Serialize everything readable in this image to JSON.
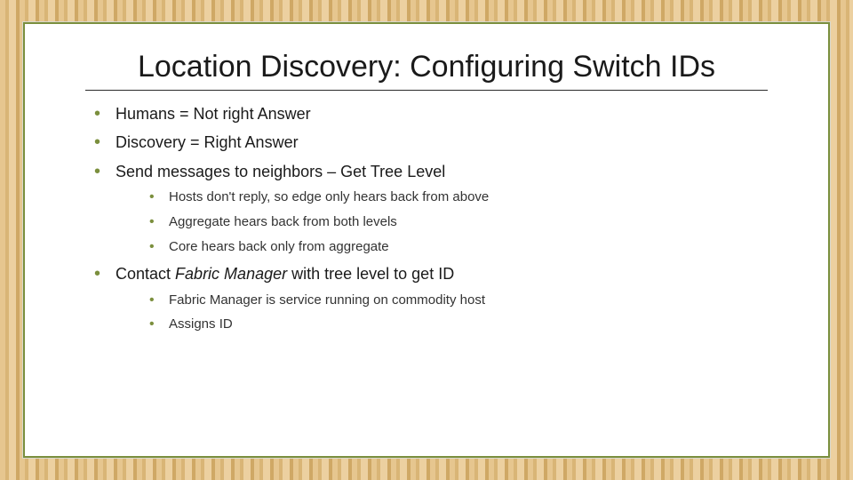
{
  "title": "Location Discovery: Configuring Switch IDs",
  "bullets": {
    "b1": "Humans = Not right Answer",
    "b2": "Discovery = Right Answer",
    "b3": "Send messages to neighbors – Get Tree Level",
    "b3_sub": {
      "s1": "Hosts don't reply, so edge only hears back from above",
      "s2": "Aggregate hears back from both levels",
      "s3": "Core hears back only from aggregate"
    },
    "b4_pre": "Contact ",
    "b4_em": "Fabric Manager",
    "b4_post": " with tree level to get ID",
    "b4_sub": {
      "s1": "Fabric Manager is service running on commodity host",
      "s2": "Assigns ID"
    }
  },
  "colors": {
    "accent": "#7b8f3d",
    "text": "#1a1a1a"
  }
}
